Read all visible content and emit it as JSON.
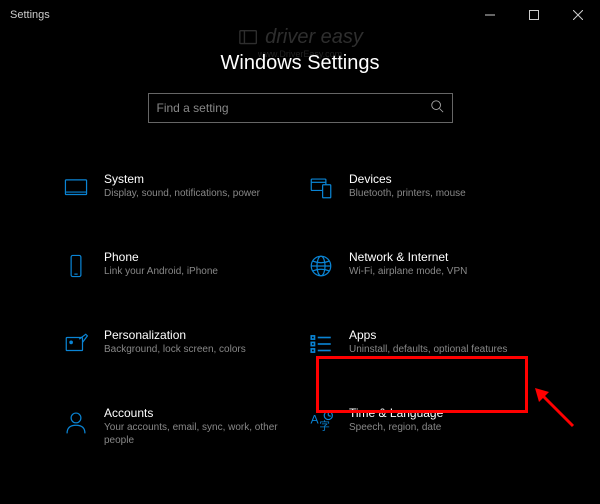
{
  "window": {
    "title": "Settings"
  },
  "watermark": {
    "brand": "driver easy",
    "url": "www.DriverEasy.com"
  },
  "header": {
    "title": "Windows Settings"
  },
  "search": {
    "placeholder": "Find a setting"
  },
  "tiles": {
    "system": {
      "title": "System",
      "desc": "Display, sound, notifications, power"
    },
    "devices": {
      "title": "Devices",
      "desc": "Bluetooth, printers, mouse"
    },
    "phone": {
      "title": "Phone",
      "desc": "Link your Android, iPhone"
    },
    "network": {
      "title": "Network & Internet",
      "desc": "Wi-Fi, airplane mode, VPN"
    },
    "personalization": {
      "title": "Personalization",
      "desc": "Background, lock screen, colors"
    },
    "apps": {
      "title": "Apps",
      "desc": "Uninstall, defaults, optional features"
    },
    "accounts": {
      "title": "Accounts",
      "desc": "Your accounts, email, sync, work, other people"
    },
    "time": {
      "title": "Time & Language",
      "desc": "Speech, region, date"
    }
  },
  "colors": {
    "accent": "#0a84d4",
    "highlight": "#ff0000"
  }
}
